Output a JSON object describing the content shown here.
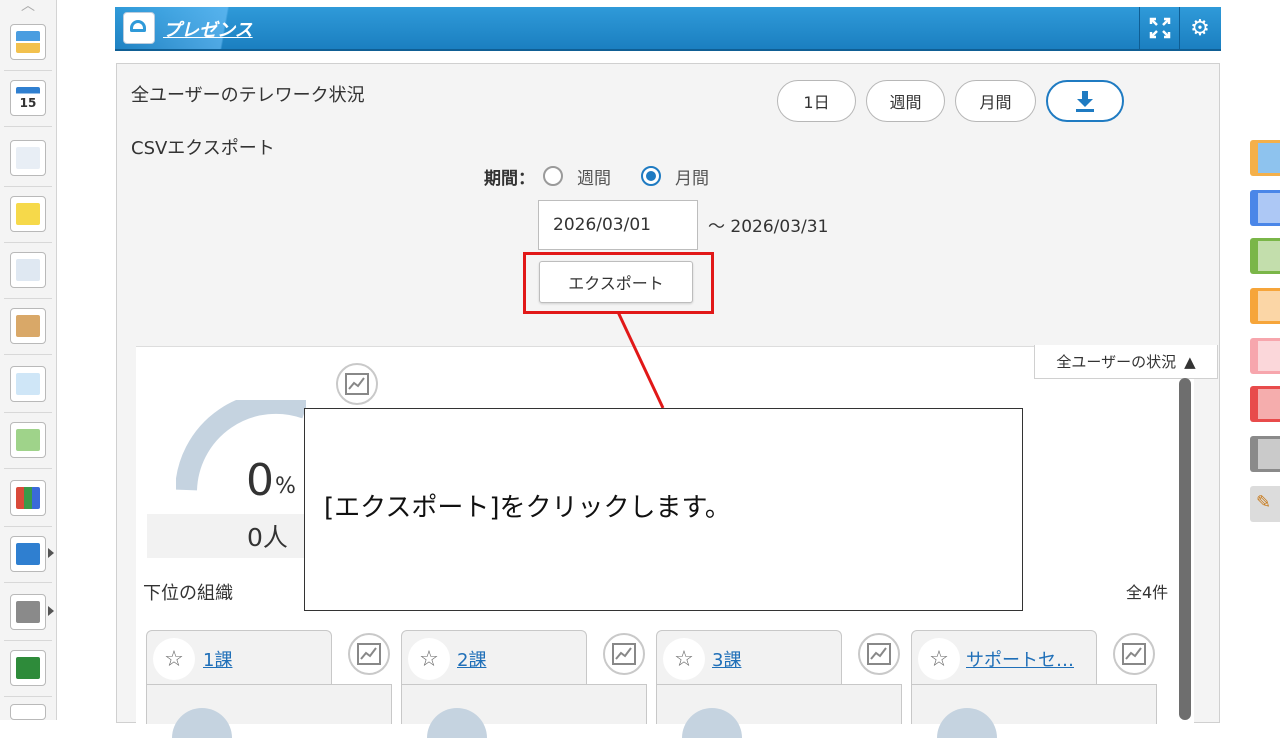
{
  "header": {
    "title": "プレゼンス",
    "icons": [
      "presence-logo-icon",
      "fullscreen-icon",
      "settings-icon"
    ]
  },
  "panel": {
    "title": "全ユーザーのテレワーク状況",
    "buttons": [
      "1日",
      "週間",
      "月間"
    ],
    "download_icon": "download-icon",
    "csv_title": "CSVエクスポート",
    "period_label": "期間：",
    "period_options": [
      "週間",
      "月間"
    ],
    "period_selected": "月間",
    "start_date": "2026/03/01",
    "end_date_text": "～ 2026/03/31",
    "export_label": "エクスポート"
  },
  "status": {
    "tab_label": "全ユーザーの状況",
    "tab_icon": "triangle-up-icon",
    "percent": "0",
    "percent_sign": "%",
    "people": "0人",
    "sub_org_label": "下位の組織",
    "total_label": "全4件",
    "orgs": [
      {
        "name": "1課"
      },
      {
        "name": "2課"
      },
      {
        "name": "3課"
      },
      {
        "name": "サポートセ…"
      }
    ]
  },
  "callout": {
    "text": "[エクスポート]をクリックします。"
  },
  "colors": {
    "accent": "#1f7bc2",
    "highlight": "#e11818",
    "header": "#1b7fc0"
  }
}
